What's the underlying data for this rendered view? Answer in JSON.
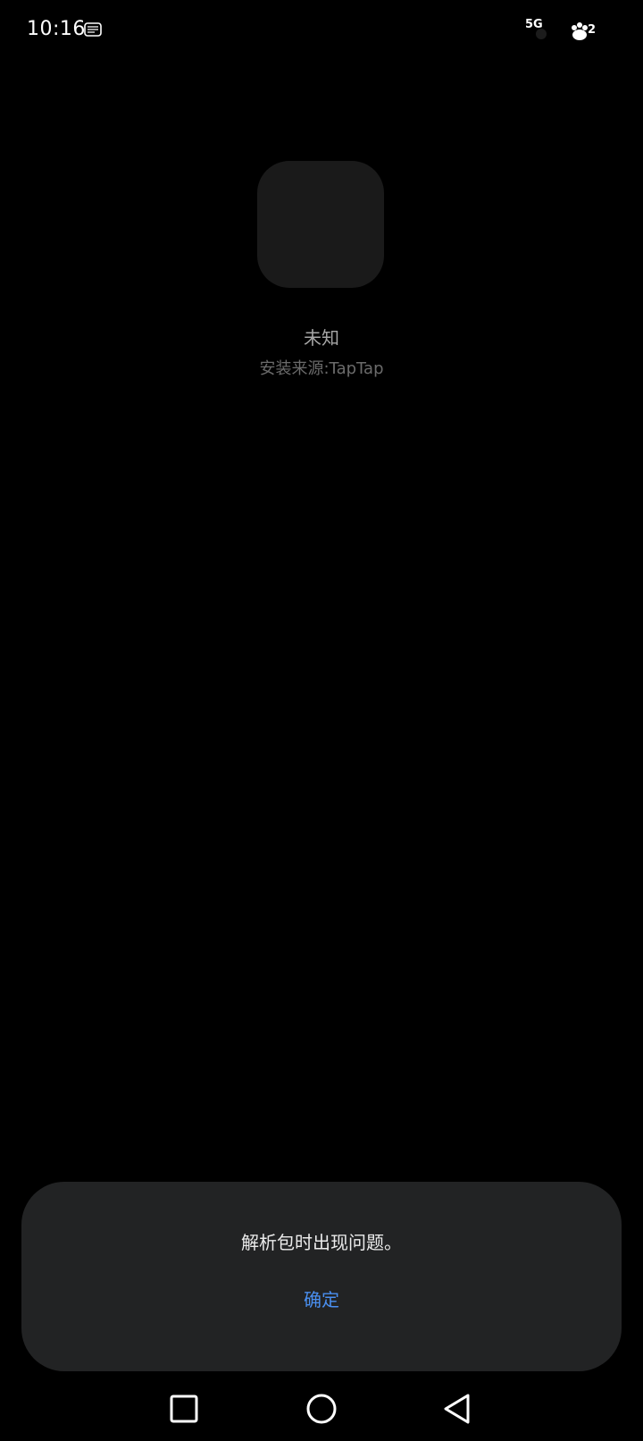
{
  "status_bar": {
    "time": "10:16",
    "network": "5G",
    "battery": "2",
    "notification_icon": "notification-app-icon",
    "signal_icon": "signal-icon",
    "battery_icon": "battery-icon"
  },
  "app": {
    "name": "未知",
    "install_source": "安装来源:TapTap",
    "icon_name": "app-placeholder-icon"
  },
  "dialog": {
    "message": "解析包时出现问题。",
    "confirm_label": "确定",
    "accent_color": "#4a8ff0"
  },
  "nav_bar": {
    "recent_icon": "square-icon",
    "home_icon": "circle-icon",
    "back_icon": "triangle-back-icon"
  }
}
